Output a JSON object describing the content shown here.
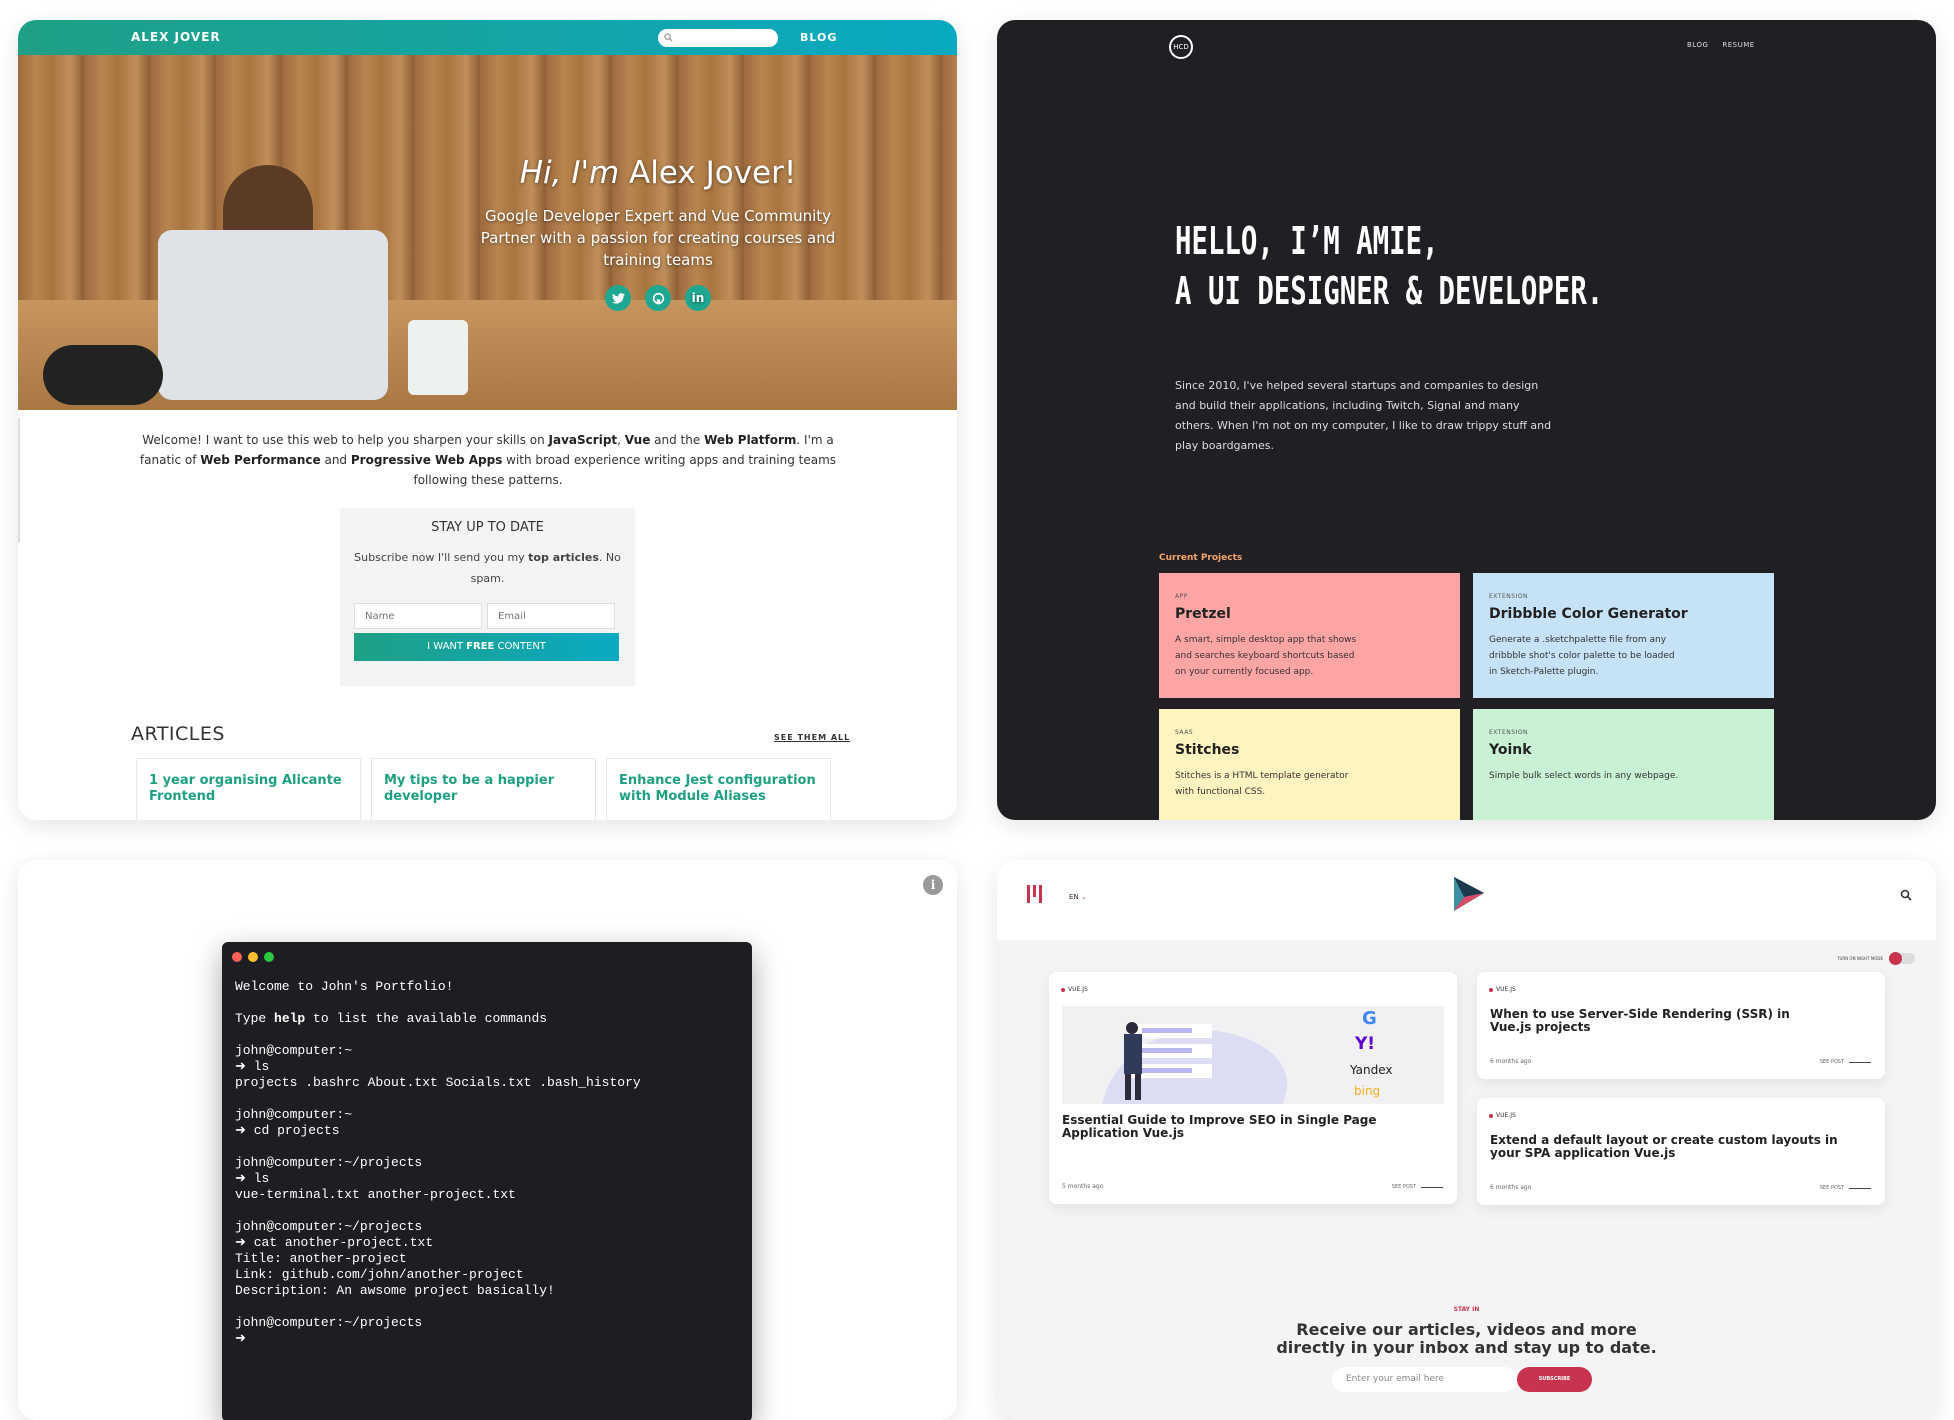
{
  "alex": {
    "brand": "ALEX JOVER",
    "nav_blog": "BLOG",
    "hero_hi": "Hi, I'm",
    "hero_name": " Alex Jover!",
    "hero_sub": "Google Developer Expert and Vue Community Partner with a passion for creating courses and training teams",
    "social": [
      "twitter-icon",
      "github-icon",
      "linkedin-icon"
    ],
    "welcome": {
      "p1": "Welcome! I want to use this web to help you sharpen your skills on ",
      "b1": "JavaScript",
      "p2": ", ",
      "b2": "Vue",
      "p3": " and the ",
      "b3": "Web Platform",
      "p4": ". I'm a fanatic of ",
      "b4": "Web Performance",
      "p5": " and ",
      "b5": "Progressive Web Apps",
      "p6": " with broad experience writing apps and training teams following these patterns."
    },
    "subscribe": {
      "title": "STAY UP TO DATE",
      "text_pre": "Subscribe now I'll send you my ",
      "text_bold": "top articles",
      "text_post": ". No spam.",
      "name_placeholder": "Name",
      "email_placeholder": "Email",
      "cta_pre": "I WANT ",
      "cta_bold": "FREE",
      "cta_post": " CONTENT"
    },
    "articles_title": "ARTICLES",
    "see_all": "SEE THEM ALL",
    "articles": [
      "1 year organising Alicante Frontend",
      "My tips to be a happier developer",
      "Enhance Jest configuration with Module Aliases"
    ]
  },
  "amie": {
    "logo": "HCD",
    "nav": [
      "BLOG",
      "RESUME"
    ],
    "title_line1": "HELLO, I’M AMIE,",
    "title_line2": "A UI DESIGNER & DEVELOPER.",
    "description": "Since 2010, I've helped several startups and companies to design and build their applications, including Twitch, Signal and many others. When I'm not on my computer, I like to draw trippy stuff and play boardgames.",
    "current_label": "Current Projects",
    "projects": [
      {
        "kind": "APP",
        "name": "Pretzel",
        "desc": "A smart, simple desktop app that shows and searches keyboard shortcuts based on your currently focused app.",
        "color": "#fda4a4"
      },
      {
        "kind": "EXTENSION",
        "name": "Dribbble Color Generator",
        "desc": "Generate a .sketchpalette file from any dribbble shot's color palette to be loaded in Sketch-Palette plugin.",
        "color": "#c6e2f7"
      },
      {
        "kind": "SAAS",
        "name": "Stitches",
        "desc": "Stitches is a HTML template generator with functional CSS.",
        "color": "#fdf4c0"
      },
      {
        "kind": "EXTENSION",
        "name": "Yoink",
        "desc": "Simple bulk select words in any webpage.",
        "color": "#c8f2d3"
      }
    ]
  },
  "terminal": {
    "lines": [
      "Welcome to John's Portfolio!",
      "",
      "Type |help| to list the available commands",
      "",
      "john@computer:~",
      "➜ ls",
      "projects .bashrc About.txt Socials.txt .bash_history",
      "",
      "john@computer:~",
      "➜ cd projects",
      "",
      "john@computer:~/projects",
      "➜ ls",
      "vue-terminal.txt another-project.txt",
      "",
      "john@computer:~/projects",
      "➜ cat another-project.txt",
      "Title: another-project",
      "Link: github.com/john/another-project",
      "Description: An awsome project basically!",
      "",
      "john@computer:~/projects",
      "➜"
    ],
    "dot_colors": [
      "#ff5f57",
      "#febc2e",
      "#28c840"
    ]
  },
  "vueblog": {
    "lang": "EN",
    "night_mode": "TURN ON NIGHT MODE",
    "posts": [
      {
        "tag": "VUE.JS",
        "title": "Essential Guide to Improve SEO in Single Page Application Vue.js",
        "ago": "5 months ago",
        "see": "SEE POST"
      },
      {
        "tag": "VUE.JS",
        "title": "When to use Server-Side Rendering (SSR) in Vue.js projects",
        "ago": "6 months ago",
        "see": "SEE POST"
      },
      {
        "tag": "VUE.JS",
        "title": "Extend a default layout or create custom layouts in your SPA application Vue.js",
        "ago": "6 months ago",
        "see": "SEE POST"
      }
    ],
    "illustration_brands": [
      "G",
      "Y!",
      "Yandex",
      "bing"
    ],
    "stay_kicker": "STAY IN",
    "stay_title": "Receive our articles, videos and more directly in your inbox and stay up to date.",
    "email_placeholder": "Enter your email here",
    "subscribe": "SUBSCRIBE",
    "accent": "#c8334f"
  }
}
